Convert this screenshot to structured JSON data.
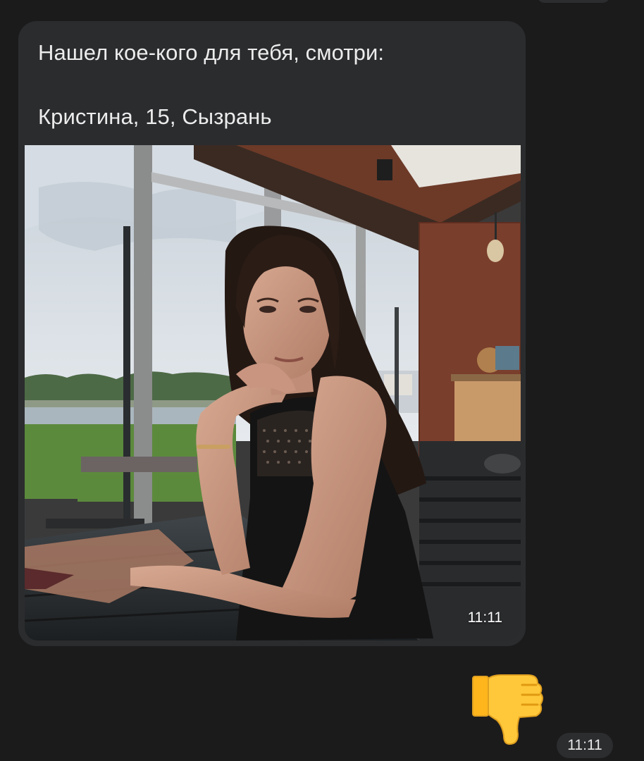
{
  "message": {
    "line1": "Нашел кое-кого для тебя, смотри:",
    "line2": "Кристина, 15, Сызрань",
    "photo_icon": "photo-image",
    "photo_time": "11:11"
  },
  "reply": {
    "emoji": "thumbs-down-icon",
    "time": "11:11"
  },
  "colors": {
    "background": "#1b1b1c",
    "bubble": "#2b2c2e",
    "text": "#ececec"
  }
}
